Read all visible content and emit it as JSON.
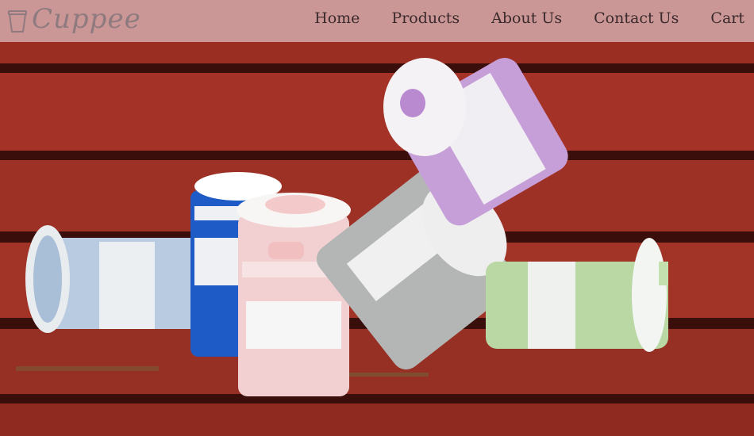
{
  "brand": {
    "name": "Cuppee",
    "logo_icon": "cup-icon"
  },
  "nav": {
    "items": [
      "Home",
      "Products",
      "About Us",
      "Contact Us",
      "Cart"
    ]
  },
  "hero": {
    "image": "collapsible-cups-on-red-bench"
  },
  "colors": {
    "navbar_bg": "#d6a5a5",
    "nav_text": "#3b2a2c",
    "bench_red": "#9b2f23",
    "cup_lavender": "#c79fd8",
    "cup_light_blue": "#b5c8df",
    "cup_blue": "#1f5bc6",
    "cup_pink": "#f2cfd0",
    "cup_gray": "#b3b6b5",
    "cup_green": "#b9d8a4"
  }
}
